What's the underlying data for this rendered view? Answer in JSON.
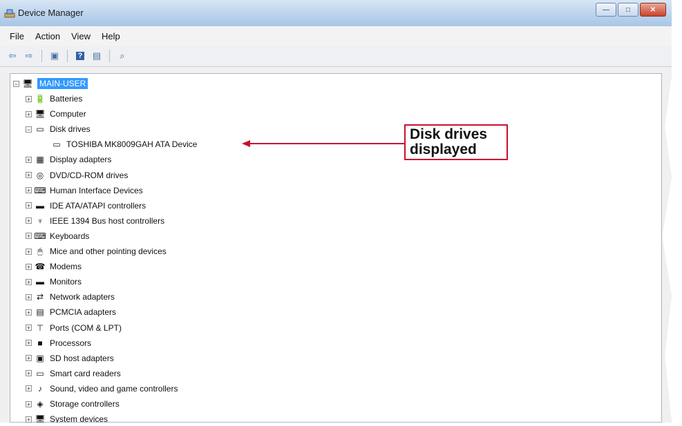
{
  "window": {
    "title": "Device Manager"
  },
  "menu": [
    "File",
    "Action",
    "View",
    "Help"
  ],
  "toolbar": {
    "icons": [
      "back-icon",
      "forward-icon",
      "properties-icon",
      "help-icon",
      "update-icon",
      "scan-hardware-icon"
    ]
  },
  "tree": {
    "root": "MAIN-USER",
    "items": [
      {
        "label": "Batteries",
        "icon": "battery-icon",
        "glyph": "🔋"
      },
      {
        "label": "Computer",
        "icon": "computer-icon",
        "glyph": "🖥"
      },
      {
        "label": "Disk drives",
        "icon": "disk-drive-icon",
        "glyph": "▭",
        "expanded": true
      },
      {
        "label": "TOSHIBA MK8009GAH ATA Device",
        "icon": "hard-disk-icon",
        "glyph": "▭",
        "child": true
      },
      {
        "label": "Display adapters",
        "icon": "display-adapter-icon",
        "glyph": "▦"
      },
      {
        "label": "DVD/CD-ROM drives",
        "icon": "dvd-drive-icon",
        "glyph": "◎"
      },
      {
        "label": "Human Interface Devices",
        "icon": "hid-icon",
        "glyph": "⌨"
      },
      {
        "label": "IDE ATA/ATAPI controllers",
        "icon": "ide-controller-icon",
        "glyph": "▬"
      },
      {
        "label": "IEEE 1394 Bus host controllers",
        "icon": "ieee1394-icon",
        "glyph": "♆"
      },
      {
        "label": "Keyboards",
        "icon": "keyboard-icon",
        "glyph": "⌨"
      },
      {
        "label": "Mice and other pointing devices",
        "icon": "mouse-icon",
        "glyph": "🖱"
      },
      {
        "label": "Modems",
        "icon": "modem-icon",
        "glyph": "☎"
      },
      {
        "label": "Monitors",
        "icon": "monitor-icon",
        "glyph": "▬"
      },
      {
        "label": "Network adapters",
        "icon": "network-adapter-icon",
        "glyph": "⇄"
      },
      {
        "label": "PCMCIA adapters",
        "icon": "pcmcia-icon",
        "glyph": "▤"
      },
      {
        "label": "Ports (COM & LPT)",
        "icon": "port-icon",
        "glyph": "⊤"
      },
      {
        "label": "Processors",
        "icon": "processor-icon",
        "glyph": "■"
      },
      {
        "label": "SD host adapters",
        "icon": "sd-adapter-icon",
        "glyph": "▣"
      },
      {
        "label": "Smart card readers",
        "icon": "smart-card-icon",
        "glyph": "▭"
      },
      {
        "label": "Sound, video and game controllers",
        "icon": "sound-icon",
        "glyph": "♪"
      },
      {
        "label": "Storage controllers",
        "icon": "storage-controller-icon",
        "glyph": "◈"
      },
      {
        "label": "System devices",
        "icon": "system-device-icon",
        "glyph": "🖥"
      }
    ]
  },
  "callout": {
    "line1": "Disk drives",
    "line2": "displayed",
    "color": "#c8102e"
  }
}
